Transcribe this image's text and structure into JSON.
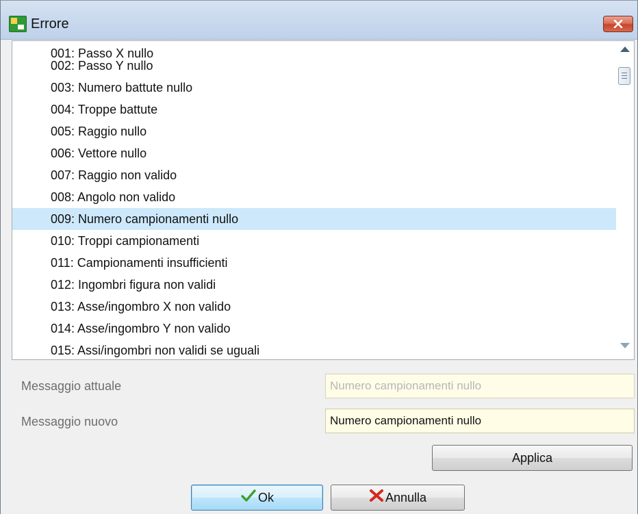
{
  "window": {
    "title": "Errore"
  },
  "list": {
    "items": [
      "001: Passo X nullo",
      "002: Passo Y nullo",
      "003: Numero battute nullo",
      "004: Troppe battute",
      "005: Raggio nullo",
      "006: Vettore nullo",
      "007: Raggio non valido",
      "008: Angolo non valido",
      "009: Numero campionamenti nullo",
      "010: Troppi campionamenti",
      "011: Campionamenti insufficienti",
      "012: Ingombri figura non validi",
      "013: Asse/ingombro X non valido",
      "014: Asse/ingombro Y non valido",
      "015: Assi/ingombri non validi se uguali"
    ],
    "selected_index": 8
  },
  "form": {
    "current_label": "Messaggio attuale",
    "current_value": "Numero campionamenti nullo",
    "new_label": "Messaggio nuovo",
    "new_value": "Numero campionamenti nullo"
  },
  "buttons": {
    "apply": "Applica",
    "ok": "Ok",
    "cancel": "Annulla"
  },
  "icons": {
    "app": "app-icon",
    "close": "close-icon",
    "ok": "checkmark-icon",
    "cancel": "x-icon"
  },
  "colors": {
    "selection": "#cde8fb",
    "field_bg": "#fffde6",
    "ok_check": "#3aa12e",
    "cancel_x": "#d22a1e"
  }
}
